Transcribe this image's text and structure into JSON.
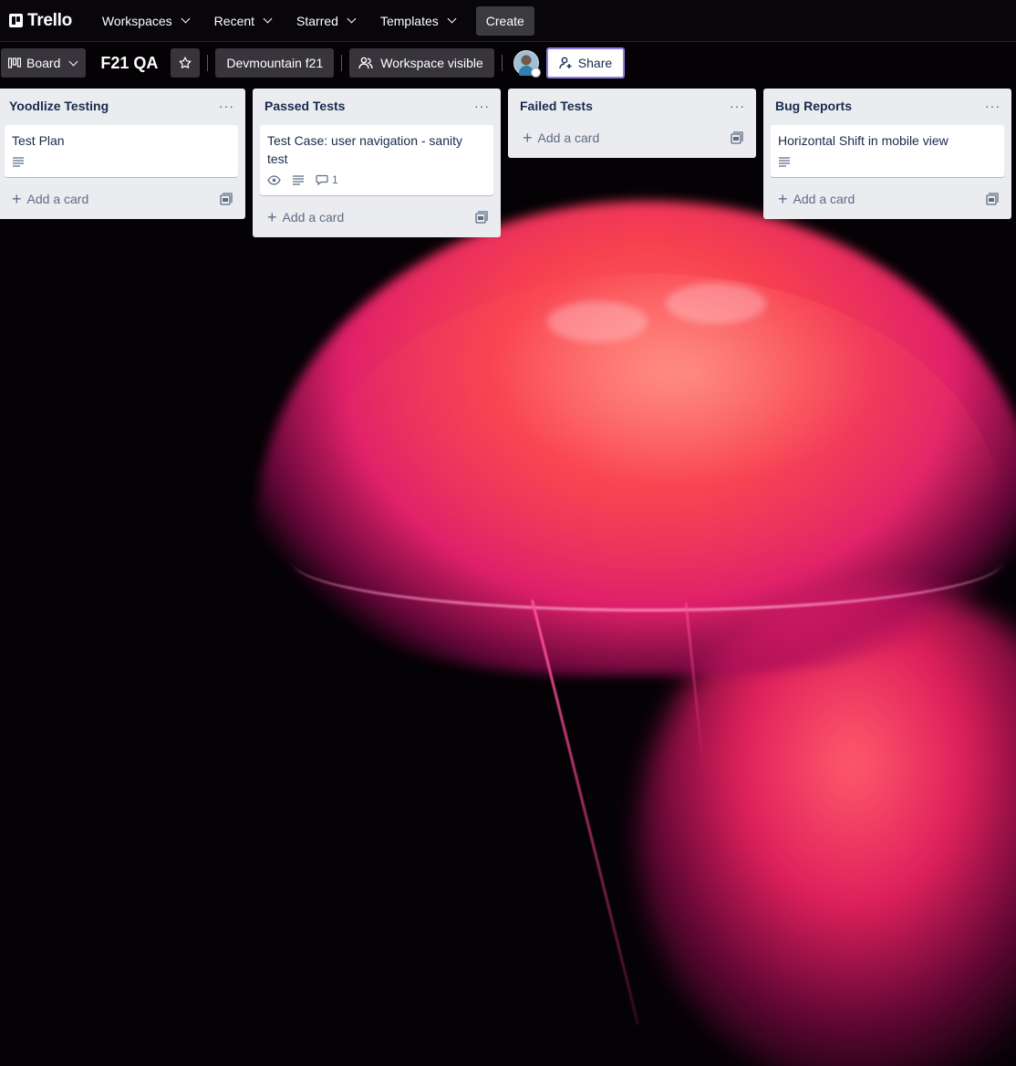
{
  "app": {
    "logo_text": "Trello"
  },
  "nav": {
    "items": [
      {
        "label": "Workspaces"
      },
      {
        "label": "Recent"
      },
      {
        "label": "Starred"
      },
      {
        "label": "Templates"
      }
    ],
    "create_label": "Create"
  },
  "board": {
    "view_label": "Board",
    "title": "F21 QA",
    "workspace_label": "Devmountain f21",
    "visibility_label": "Workspace visible",
    "share_label": "Share"
  },
  "lists": [
    {
      "title": "Yoodlize Testing",
      "cards": [
        {
          "title": "Test Plan",
          "has_description": true
        }
      ],
      "add_card_label": "Add a card"
    },
    {
      "title": "Passed Tests",
      "cards": [
        {
          "title": "Test Case: user navigation - sanity test",
          "watching": true,
          "has_description": true,
          "comments": "1"
        }
      ],
      "add_card_label": "Add a card"
    },
    {
      "title": "Failed Tests",
      "cards": [],
      "add_card_label": "Add a card"
    },
    {
      "title": "Bug Reports",
      "cards": [
        {
          "title": "Horizontal Shift in mobile view",
          "has_description": true
        }
      ],
      "add_card_label": "Add a card"
    }
  ],
  "colors": {
    "list_bg": "#ebecf0",
    "text": "#172b4d",
    "share_border": "#8f7ee7"
  }
}
